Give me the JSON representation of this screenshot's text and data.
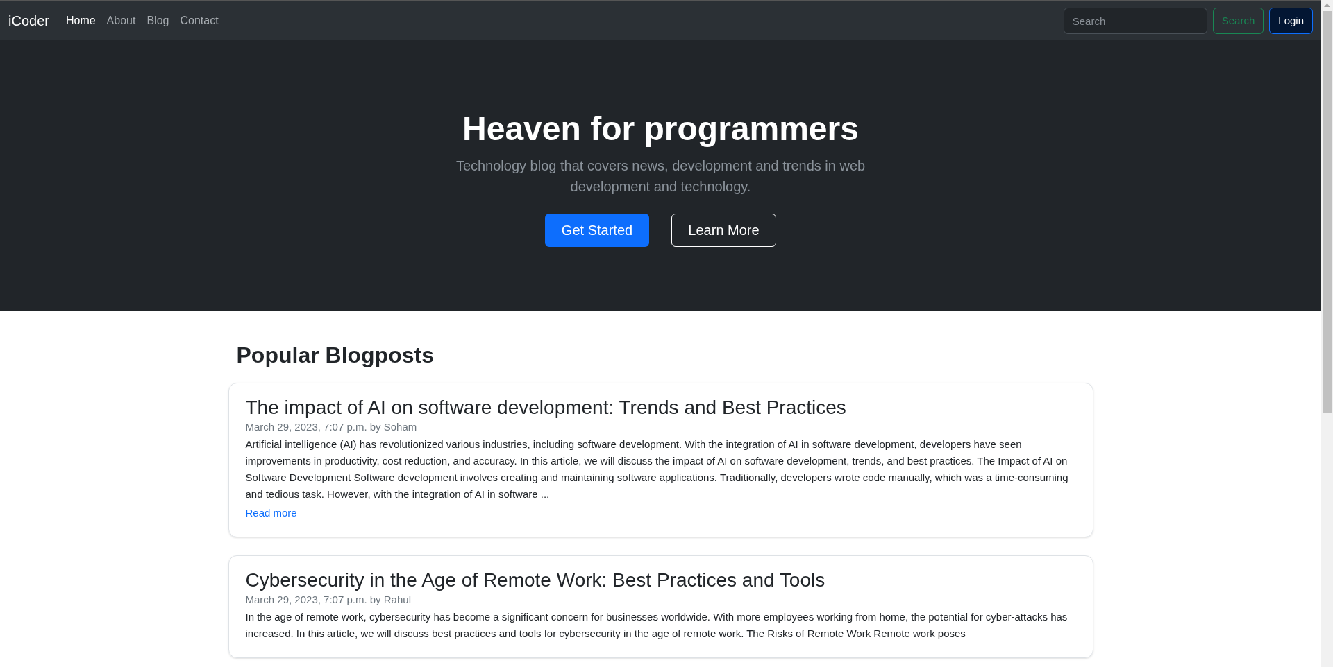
{
  "navbar": {
    "brand": "iCoder",
    "links": [
      {
        "label": "Home",
        "selected": true
      },
      {
        "label": "About",
        "selected": false
      },
      {
        "label": "Blog",
        "selected": false
      },
      {
        "label": "Contact",
        "selected": false
      }
    ],
    "search": {
      "placeholder": "Search"
    },
    "search_button": "Search",
    "login_button": "Login"
  },
  "hero": {
    "title": "Heaven for programmers",
    "subtitle": "Technology blog that covers news, development and trends in web development and technology.",
    "primary_button": "Get Started",
    "secondary_button": "Learn More"
  },
  "section_title": "Popular Blogposts",
  "posts": [
    {
      "title": "The impact of AI on software development: Trends and Best Practices",
      "meta": "March 29, 2023, 7:07 p.m. by Soham",
      "body": "Artificial intelligence (AI) has revolutionized various industries, including software development. With the integration of AI in software development, developers have seen improvements in productivity, cost reduction, and accuracy. In this article, we will discuss the impact of AI on software development, trends, and best practices. The Impact of AI on Software Development Software development involves creating and maintaining software applications. Traditionally, developers wrote code manually, which was a time-consuming and tedious task. However, with the integration of AI in software ...",
      "link": "Read more"
    },
    {
      "title": "Cybersecurity in the Age of Remote Work: Best Practices and Tools",
      "meta": "March 29, 2023, 7:07 p.m. by Rahul",
      "body": "In the age of remote work, cybersecurity has become a significant concern for businesses worldwide. With more employees working from home, the potential for cyber-attacks has increased. In this article, we will discuss best practices and tools for cybersecurity in the age of remote work. The Risks of Remote Work Remote work poses"
    }
  ]
}
